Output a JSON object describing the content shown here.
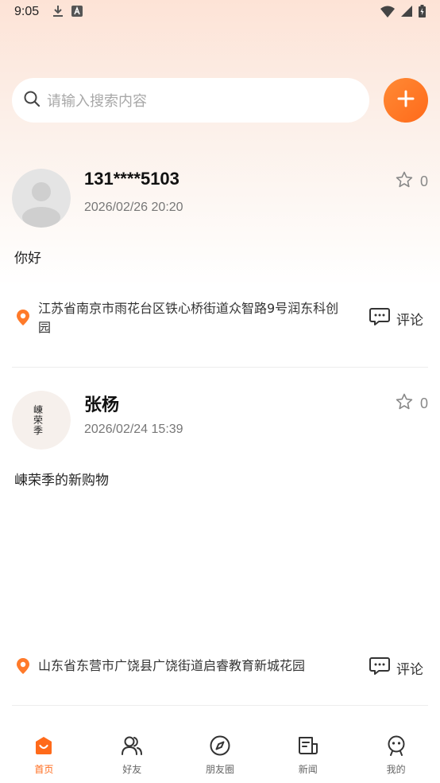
{
  "status_bar": {
    "time": "9:05"
  },
  "search": {
    "placeholder": "请输入搜索内容"
  },
  "posts": [
    {
      "name": "131****5103",
      "time": "2026/02/26 20:20",
      "star_count": "0",
      "content": "你好",
      "location": "江苏省南京市雨花台区铁心桥街道众智路9号润东科创园",
      "comment_label": "评论",
      "avatar": "default-avatar"
    },
    {
      "name": "张杨",
      "time": "2026/02/24 15:39",
      "star_count": "0",
      "content": "崠荣季的新购物",
      "location": "山东省东营市广饶县广饶街道启睿教育新城花园",
      "comment_label": "评论",
      "avatar": "calligraphy-avatar",
      "avatar_text": "崠荣季"
    }
  ],
  "bottom_nav": {
    "items": [
      {
        "label": "首页",
        "icon": "home-icon",
        "active": true
      },
      {
        "label": "好友",
        "icon": "friends-icon",
        "active": false
      },
      {
        "label": "朋友圈",
        "icon": "compass-icon",
        "active": false
      },
      {
        "label": "新闻",
        "icon": "news-icon",
        "active": false
      },
      {
        "label": "我的",
        "icon": "profile-icon",
        "active": false
      }
    ]
  },
  "colors": {
    "accent": "#ff6a1a",
    "background_top": "#fde3d6"
  }
}
